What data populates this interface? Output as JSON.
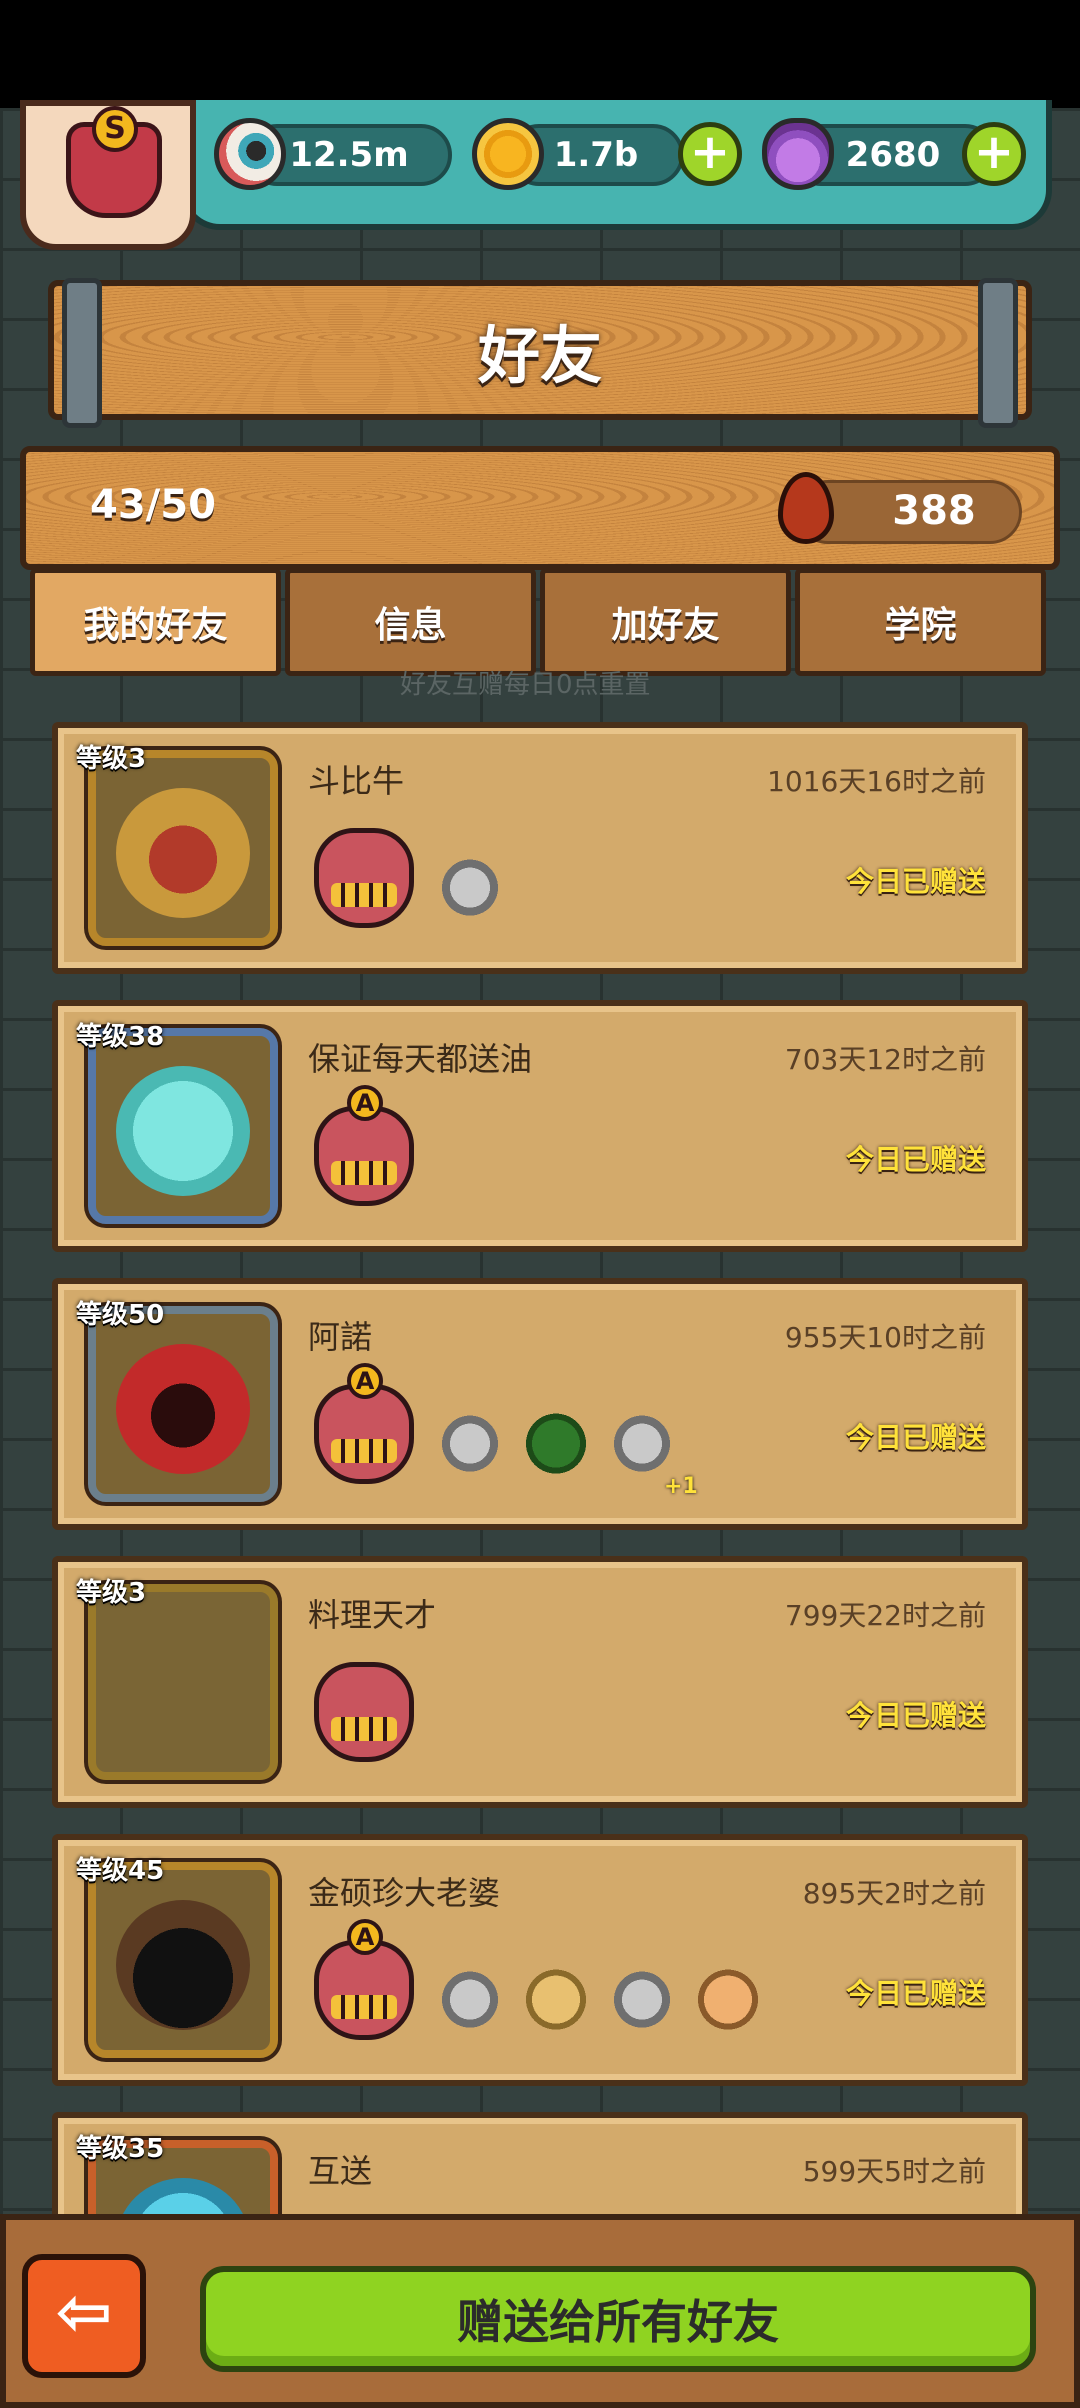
{
  "currency": {
    "eyes": "12.5m",
    "coins": "1.7b",
    "potions": "2680"
  },
  "player_badge_letter": "S",
  "title": "好友",
  "friend_count": "43/50",
  "drops": "388",
  "tabs": [
    {
      "label": "我的好友"
    },
    {
      "label": "信息"
    },
    {
      "label": "加好友"
    },
    {
      "label": "学院"
    }
  ],
  "partially_visible_hint": "好友互赠每日0点重置",
  "friends": [
    {
      "level": "等级3",
      "name": "斗比牛",
      "time": "1016天16时之前",
      "status": "今日已赠送",
      "badge_letter": "",
      "extra": ""
    },
    {
      "level": "等级38",
      "name": "保证每天都送油",
      "time": "703天12时之前",
      "status": "今日已赠送",
      "badge_letter": "A",
      "extra": ""
    },
    {
      "level": "等级50",
      "name": "阿諾",
      "time": "955天10时之前",
      "status": "今日已赠送",
      "badge_letter": "A",
      "extra": "+1"
    },
    {
      "level": "等级3",
      "name": "料理天才",
      "time": "799天22时之前",
      "status": "今日已赠送",
      "badge_letter": "",
      "extra": ""
    },
    {
      "level": "等级45",
      "name": "金硕珍大老婆",
      "time": "895天2时之前",
      "status": "今日已赠送",
      "badge_letter": "A",
      "extra": ""
    },
    {
      "level": "等级35",
      "name": "互送",
      "time": "599天5时之前",
      "status": "",
      "badge_letter": "",
      "extra": ""
    }
  ],
  "buttons": {
    "back": "⇦",
    "gift_all": "赠送给所有好友",
    "plus": "+"
  }
}
